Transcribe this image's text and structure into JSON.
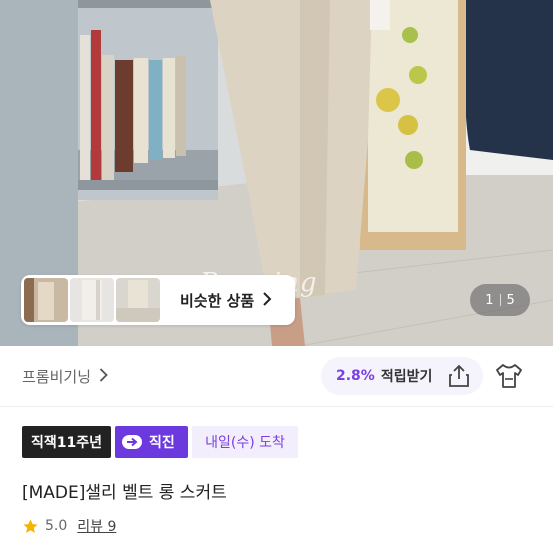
{
  "hero": {
    "watermark": "Perming",
    "similar_button": {
      "label": "비슷한 상품",
      "chevron_icon": "chevron-right-icon"
    },
    "thumbnails": [
      {
        "name": "thumb-1"
      },
      {
        "name": "thumb-2"
      },
      {
        "name": "thumb-3"
      }
    ],
    "pager": {
      "current": "1",
      "total": "5"
    }
  },
  "store": {
    "name": "프롬비기닝",
    "chevron_icon": "chevron-right-icon",
    "reward": {
      "percent": "2.8%",
      "label": "적립받기"
    },
    "share_icon": "share-icon",
    "tryon_icon": "shirt-icon"
  },
  "badges": {
    "years": "직잭11주년",
    "direct": "직진",
    "direct_icon": "arrow-circle-icon",
    "arrival": "내일(수) 도착"
  },
  "product": {
    "title": "[MADE]샐리 벨트 롱 스커트",
    "rating": "5.0",
    "review_label": "리뷰 9",
    "star_icon": "star-icon"
  },
  "colors": {
    "accent": "#7b3fe4",
    "direct_badge": "#6c39de",
    "star": "#f4b400"
  }
}
